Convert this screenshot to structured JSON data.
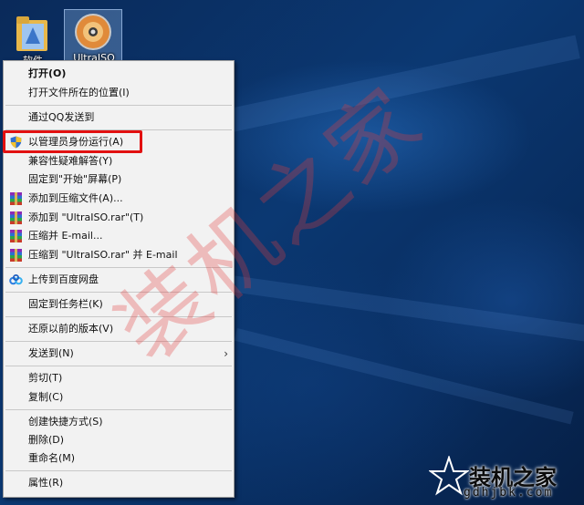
{
  "desktop": {
    "icons": [
      {
        "label": "软件",
        "icon": "folder-icon"
      },
      {
        "label": "UltraISO",
        "icon": "ultraiso-disc-icon"
      }
    ]
  },
  "menu": {
    "items": [
      {
        "label": "打开(O)",
        "icon": null
      },
      {
        "label": "打开文件所在的位置(I)",
        "icon": null
      },
      {
        "label": "通过QQ发送到",
        "icon": null
      },
      {
        "label": "以管理员身份运行(A)",
        "icon": "uac-shield-icon"
      },
      {
        "label": "兼容性疑难解答(Y)",
        "icon": null
      },
      {
        "label": "固定到\"开始\"屏幕(P)",
        "icon": null
      },
      {
        "label": "添加到压缩文件(A)...",
        "icon": "winrar-icon"
      },
      {
        "label": "添加到 \"UltraISO.rar\"(T)",
        "icon": "winrar-icon"
      },
      {
        "label": "压缩并 E-mail...",
        "icon": "winrar-icon"
      },
      {
        "label": "压缩到 \"UltraISO.rar\" 并 E-mail",
        "icon": "winrar-icon"
      },
      {
        "label": "上传到百度网盘",
        "icon": "baidu-netdisk-icon"
      },
      {
        "label": "固定到任务栏(K)",
        "icon": null
      },
      {
        "label": "还原以前的版本(V)",
        "icon": null
      },
      {
        "label": "发送到(N)",
        "icon": null,
        "submenu_arrow": "›"
      },
      {
        "label": "剪切(T)",
        "icon": null
      },
      {
        "label": "复制(C)",
        "icon": null
      },
      {
        "label": "创建快捷方式(S)",
        "icon": null
      },
      {
        "label": "删除(D)",
        "icon": null
      },
      {
        "label": "重命名(M)",
        "icon": null
      },
      {
        "label": "属性(R)",
        "icon": null
      }
    ]
  },
  "annotation": {
    "color": "#e21010"
  },
  "watermark": {
    "text": "装机之家"
  },
  "brand": {
    "name": "装机之家",
    "url": "gdhjbk.com"
  }
}
